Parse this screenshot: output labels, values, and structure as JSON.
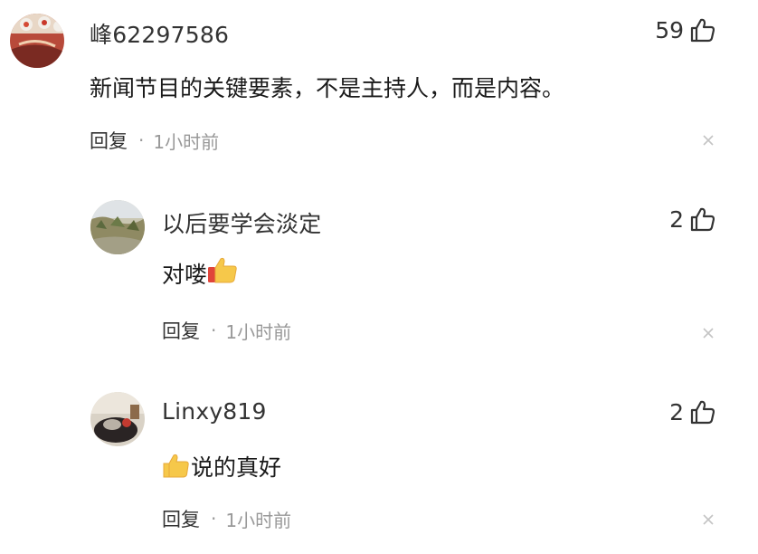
{
  "comments": [
    {
      "username": "峰62297586",
      "content": "新闻节目的关键要素，不是主持人，而是内容。",
      "likes": "59",
      "reply_label": "回复",
      "separator": "·",
      "time": "1小时前"
    },
    {
      "username": "以后要学会淡定",
      "content": "对喽",
      "content_emoji": "thumbs-up-emoji",
      "likes": "2",
      "reply_label": "回复",
      "separator": "·",
      "time": "1小时前"
    },
    {
      "username": "Linxy819",
      "content": "说的真好",
      "content_emoji": "thumbs-up-emoji",
      "likes": "2",
      "reply_label": "回复",
      "separator": "·",
      "time": "1小时前"
    }
  ],
  "colors": {
    "text": "#1a1a1a",
    "meta": "#999999",
    "emoji_thumb": "#f6c84a",
    "emoji_cuff": "#e0453a"
  },
  "icons": [
    "thumb-up-icon",
    "close-icon",
    "avatar"
  ]
}
